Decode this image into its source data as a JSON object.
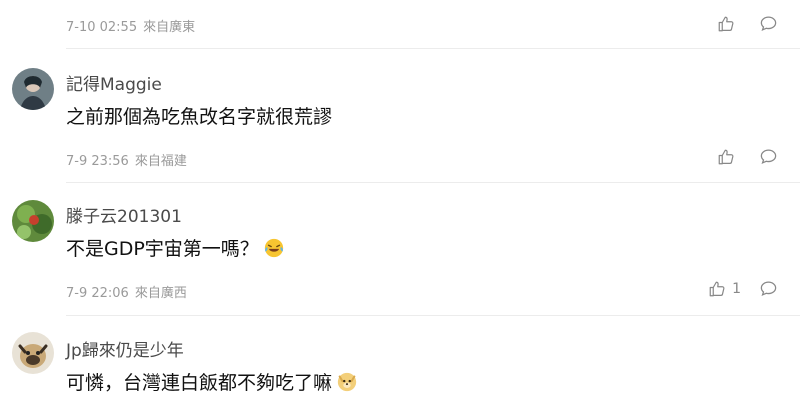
{
  "comments": [
    {
      "username": "",
      "content": "",
      "date": "7-10 02:55",
      "location": "來自廣東",
      "likes": ""
    },
    {
      "username": "記得Maggie",
      "content": "之前那個為吃魚改名字就很荒謬",
      "date": "7-9 23:56",
      "location": "來自福建",
      "likes": ""
    },
    {
      "username": "滕子云201301",
      "content": "不是GDP宇宙第一嗎？",
      "date": "7-9 22:06",
      "location": "來自廣西",
      "likes": "1"
    },
    {
      "username": "Jp歸來仍是少年",
      "content": "可憐，台灣連白飯都不夠吃了嘛",
      "date": "",
      "location": "",
      "likes": ""
    }
  ],
  "icons": {
    "like": "thumbs-up-icon",
    "reply": "comment-bubble-icon",
    "emoji_laugh": "laughing-crying-emoji-icon",
    "emoji_doge": "doge-emoji-icon"
  },
  "colors": {
    "text": "#111111",
    "username": "#4a4a4a",
    "meta": "#9a9a9a",
    "icon": "#888888",
    "divider": "#ececec"
  }
}
